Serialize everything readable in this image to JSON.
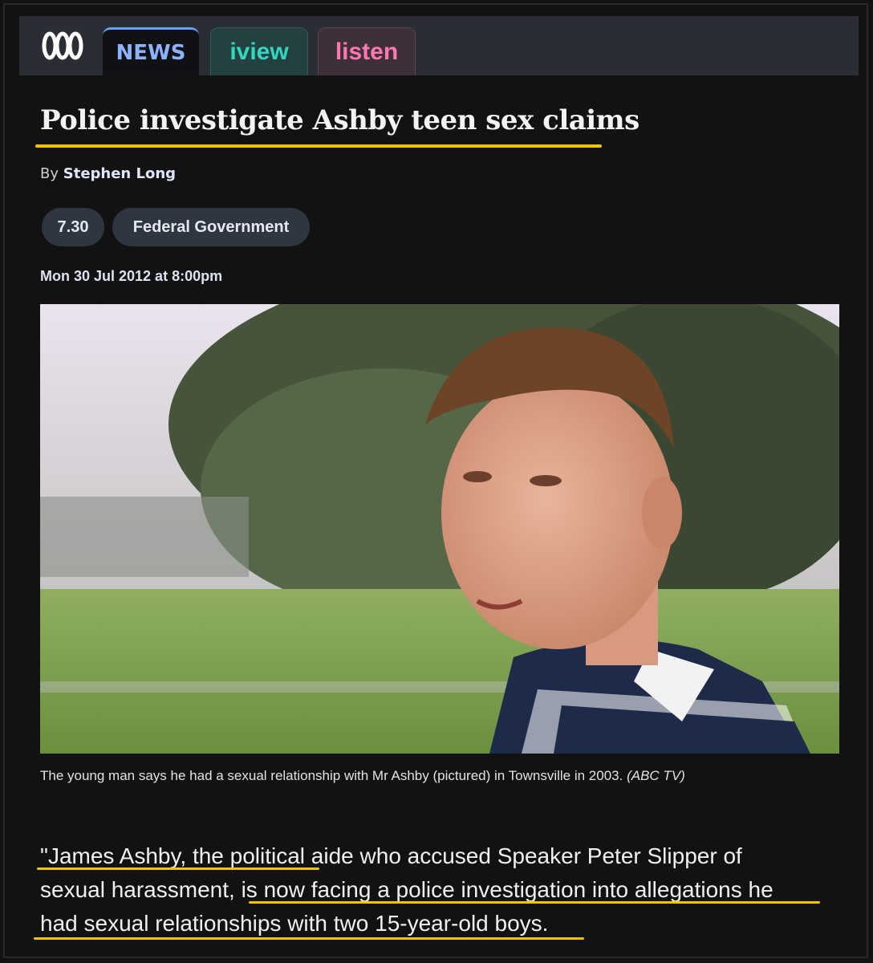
{
  "nav": {
    "logo": "abc-logo",
    "tabs": [
      {
        "label": "NEWS",
        "active": true
      },
      {
        "label": "iview",
        "active": false
      },
      {
        "label": "listen",
        "active": false
      }
    ]
  },
  "article": {
    "headline": "Police investigate Ashby teen sex claims",
    "byline_prefix": "By",
    "author": "Stephen Long",
    "tags": [
      "7.30",
      "Federal Government"
    ],
    "date": "Mon 30 Jul 2012 at 8:00pm",
    "image": "photo of man in striped polo shirt outdoors in a field",
    "caption": "The young man says he had a sexual relationship with Mr Ashby (pictured) in Townsville in 2003.",
    "caption_credit": "(ABC TV)",
    "quote_lines": [
      "\"James Ashby, the political aide who accused Speaker Peter Slipper of",
      "sexual harassment, is now facing a police investigation into allegations he",
      "had sexual relationships with two 15-year-old boys."
    ]
  },
  "colors": {
    "background": "#121212",
    "nav_bar": "#2a2d33",
    "highlight_underline": "#f0c400",
    "news_tab": "#8bb3ff",
    "iview_tab": "#33d6c0",
    "listen_tab": "#ff77b3"
  }
}
